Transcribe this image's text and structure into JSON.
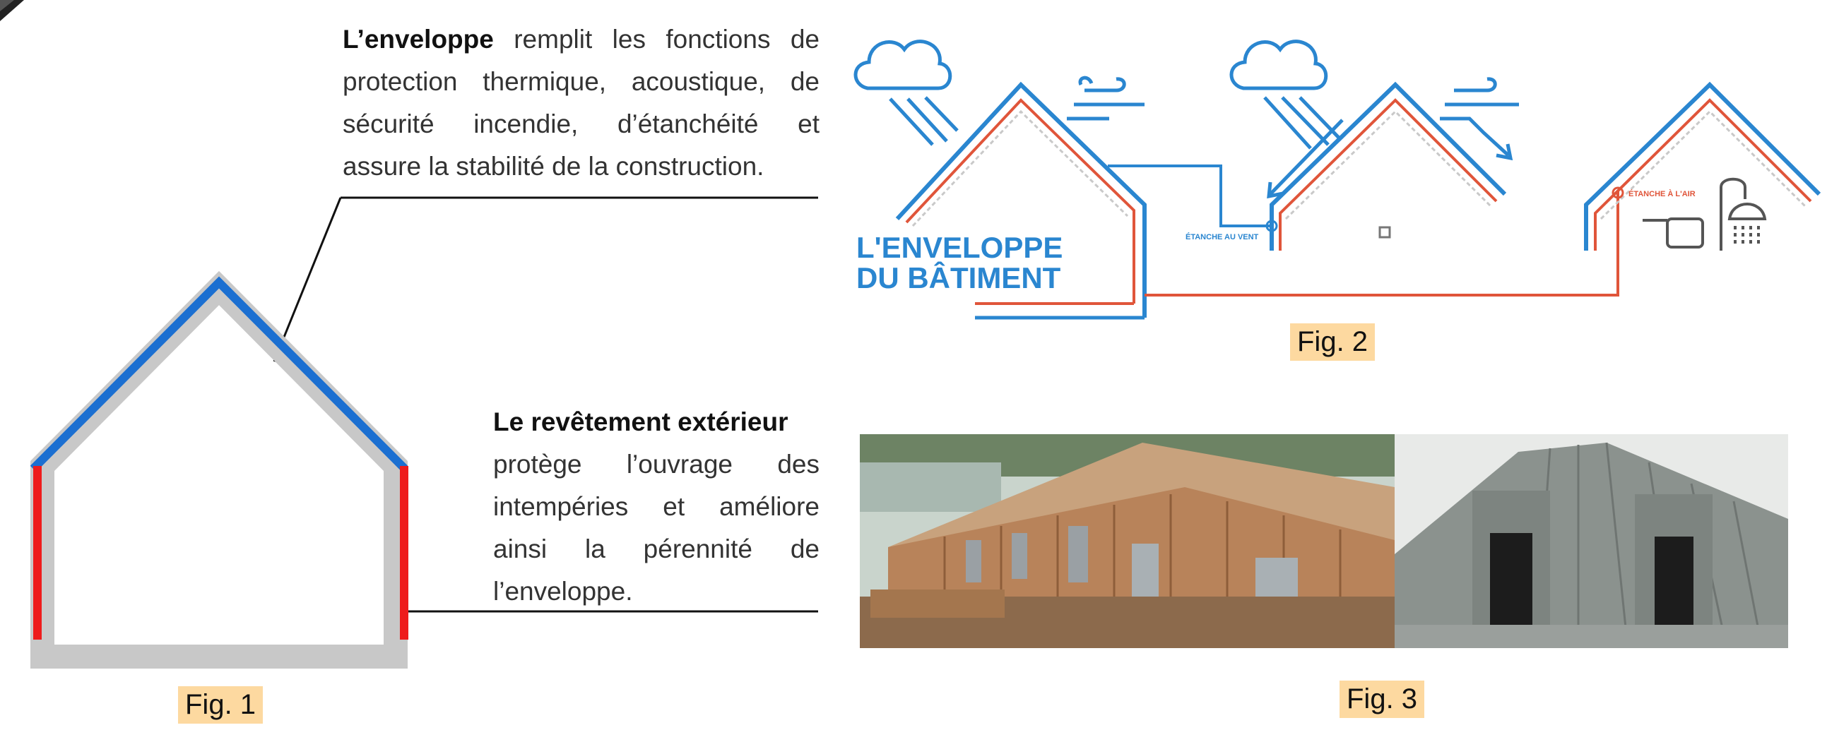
{
  "paragraph1": {
    "bold": "L’enveloppe",
    "line1": " remplit les fonctions de",
    "line2": "protection thermique, acoustique, de",
    "line3": "sécurité incendie, d’étanchéité et",
    "line4": "assure la stabilité de la  construction."
  },
  "paragraph2": {
    "bold": "Le revêtement extérieur",
    "line2": "protège l’ouvrage des",
    "line3": "intempéries et améliore",
    "line4": "ainsi  la pérennité de",
    "line5": "l’enveloppe."
  },
  "fig2": {
    "title_line1": "L'ENVELOPPE",
    "title_line2": "DU BÂTIMENT",
    "label_wind": "ÉTANCHE AU VENT",
    "label_air": "ÉTANCHE À L'AIR"
  },
  "captions": {
    "fig1": "Fig. 1",
    "fig2": "Fig. 2",
    "fig3": "Fig. 3"
  },
  "colors": {
    "roof_blue": "#1b6fd1",
    "wall_red": "#ee1c1c",
    "insulation_gray": "#c8c8c8",
    "diagram_blue": "#2a86d0",
    "diagram_red": "#e0553a",
    "caption_bg": "#fdd9a0"
  }
}
